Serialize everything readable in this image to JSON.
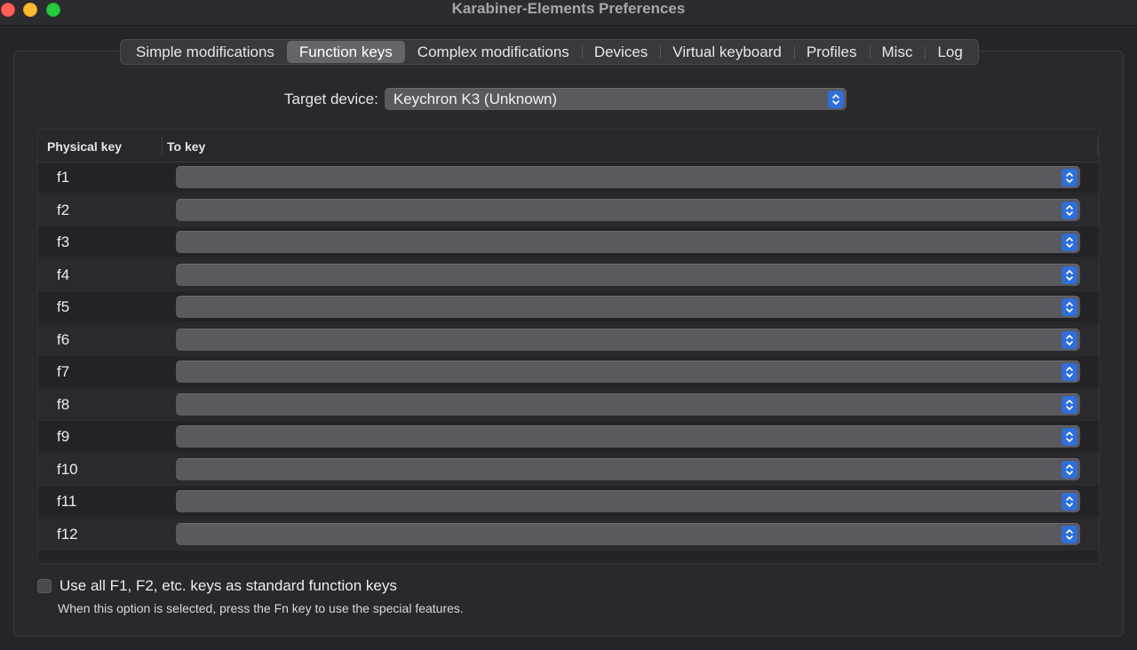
{
  "window": {
    "title": "Karabiner-Elements Preferences"
  },
  "tabs": [
    {
      "label": "Simple modifications",
      "active": false
    },
    {
      "label": "Function keys",
      "active": true
    },
    {
      "label": "Complex modifications",
      "active": false
    },
    {
      "label": "Devices",
      "active": false
    },
    {
      "label": "Virtual keyboard",
      "active": false
    },
    {
      "label": "Profiles",
      "active": false
    },
    {
      "label": "Misc",
      "active": false
    },
    {
      "label": "Log",
      "active": false
    }
  ],
  "target": {
    "label": "Target device:",
    "value": "Keychron K3 (Unknown)"
  },
  "table": {
    "headers": {
      "physical": "Physical key",
      "to": "To key"
    },
    "rows": [
      {
        "key": "f1",
        "to": ""
      },
      {
        "key": "f2",
        "to": ""
      },
      {
        "key": "f3",
        "to": ""
      },
      {
        "key": "f4",
        "to": ""
      },
      {
        "key": "f5",
        "to": ""
      },
      {
        "key": "f6",
        "to": ""
      },
      {
        "key": "f7",
        "to": ""
      },
      {
        "key": "f8",
        "to": ""
      },
      {
        "key": "f9",
        "to": ""
      },
      {
        "key": "f10",
        "to": ""
      },
      {
        "key": "f11",
        "to": ""
      },
      {
        "key": "f12",
        "to": ""
      }
    ]
  },
  "options": {
    "use_fkeys_label": "Use all F1, F2, etc. keys as standard function keys",
    "use_fkeys_checked": false,
    "hint": "When this option is selected, press the Fn key to use the special features."
  },
  "colors": {
    "accent": "#2f6fd8",
    "close": "#fe5f57",
    "minimize": "#febc2e",
    "maximize": "#28c840"
  }
}
